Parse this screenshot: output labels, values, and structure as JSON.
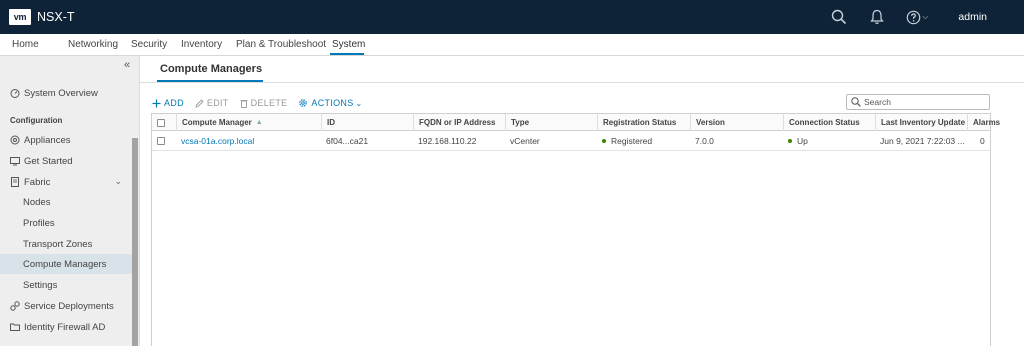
{
  "header": {
    "logo": "vm",
    "title": "NSX-T",
    "user": "admin"
  },
  "nav": {
    "tabs": [
      "Home",
      "Networking",
      "Security",
      "Inventory",
      "Plan & Troubleshoot",
      "System"
    ],
    "active": "System"
  },
  "sidebar": {
    "system_overview": "System Overview",
    "section_configuration": "Configuration",
    "items": [
      "Appliances",
      "Get Started",
      "Fabric"
    ],
    "fabric_children": [
      "Nodes",
      "Profiles",
      "Transport Zones",
      "Compute Managers",
      "Settings"
    ],
    "bottom_items": [
      "Service Deployments",
      "Identity Firewall AD"
    ],
    "selected": "Compute Managers"
  },
  "page": {
    "title": "Compute Managers"
  },
  "toolbar": {
    "add": "ADD",
    "edit": "EDIT",
    "delete": "DELETE",
    "actions": "ACTIONS"
  },
  "search": {
    "placeholder": "Search"
  },
  "grid": {
    "columns": [
      "Compute Manager",
      "ID",
      "FQDN or IP Address",
      "Type",
      "Registration Status",
      "Version",
      "Connection Status",
      "Last Inventory Update",
      "Alarms"
    ],
    "rows": [
      {
        "compute_manager": "vcsa-01a.corp.local",
        "id": "6f04...ca21",
        "fqdn": "192.168.110.22",
        "type": "vCenter",
        "registration_status": "Registered",
        "version": "7.0.0",
        "connection_status": "Up",
        "last_inventory_update": "Jun 9, 2021 7:22:03 ...",
        "alarms": "0"
      }
    ]
  },
  "colors": {
    "header_bg": "#0f2338",
    "accent": "#0079b8",
    "status_ok": "#3c8500"
  },
  "icons": [
    "search-icon",
    "bell-icon",
    "help-icon",
    "collapse-icon",
    "dashboard-icon",
    "appliance-icon",
    "monitor-icon",
    "fabric-icon",
    "chevron-down-icon",
    "plus-icon",
    "pencil-icon",
    "trash-icon",
    "gear-icon",
    "service-icon",
    "folder-icon"
  ]
}
